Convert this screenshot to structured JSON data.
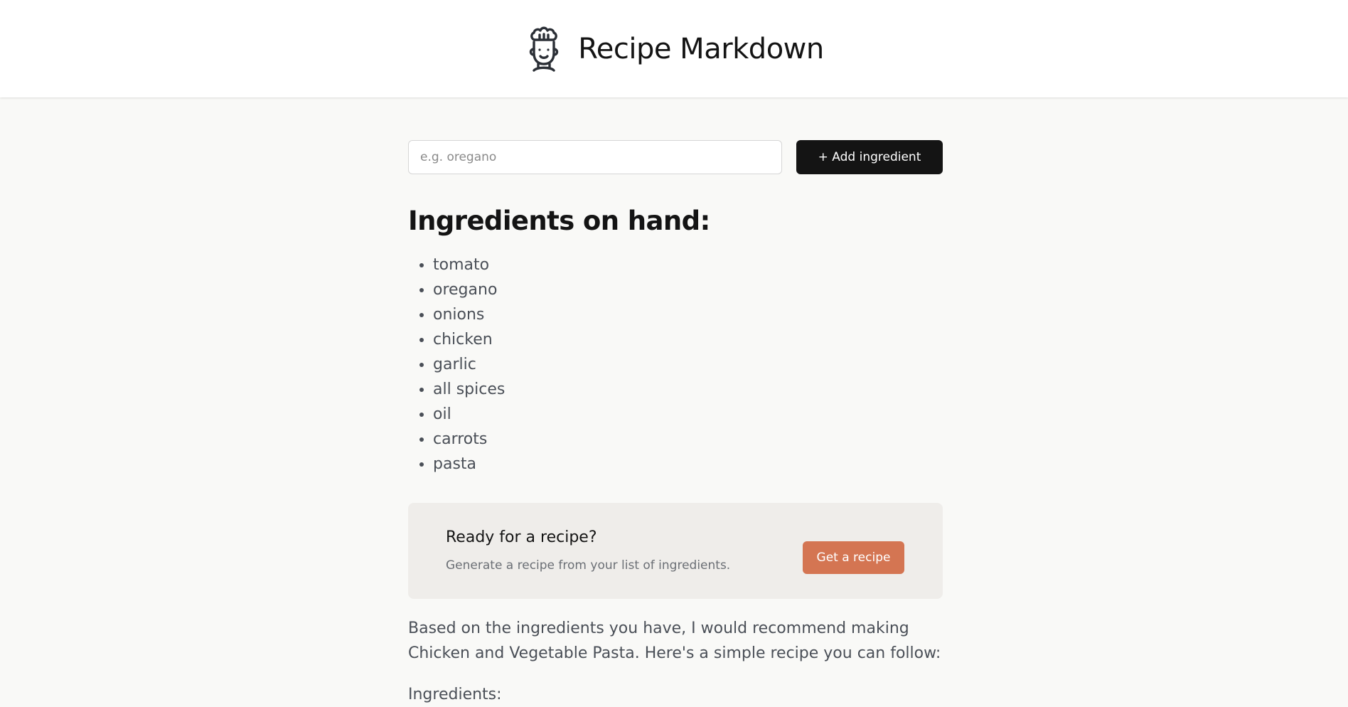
{
  "header": {
    "title": "Recipe Markdown",
    "logo_icon": "chef-icon"
  },
  "ingredient_form": {
    "input_placeholder": "e.g. oregano",
    "input_value": "",
    "add_button_label": "+ Add ingredient"
  },
  "ingredients": {
    "heading": "Ingredients on hand:",
    "items": [
      "tomato",
      "oregano",
      "onions",
      "chicken",
      "garlic",
      "all spices",
      "oil",
      "carrots",
      "pasta"
    ]
  },
  "recipe_panel": {
    "heading": "Ready for a recipe?",
    "subtext": "Generate a recipe from your list of ingredients.",
    "button_label": "Get a recipe"
  },
  "response": {
    "intro": "Based on the ingredients you have, I would recommend making Chicken and Vegetable Pasta. Here's a simple recipe you can follow:",
    "next_line": "Ingredients:"
  },
  "colors": {
    "page_background": "#f9f9f7",
    "header_background": "#ffffff",
    "primary_button": "#141414",
    "accent_button": "#d47552",
    "panel_background": "#efedea",
    "body_text": "#4a4f57"
  }
}
